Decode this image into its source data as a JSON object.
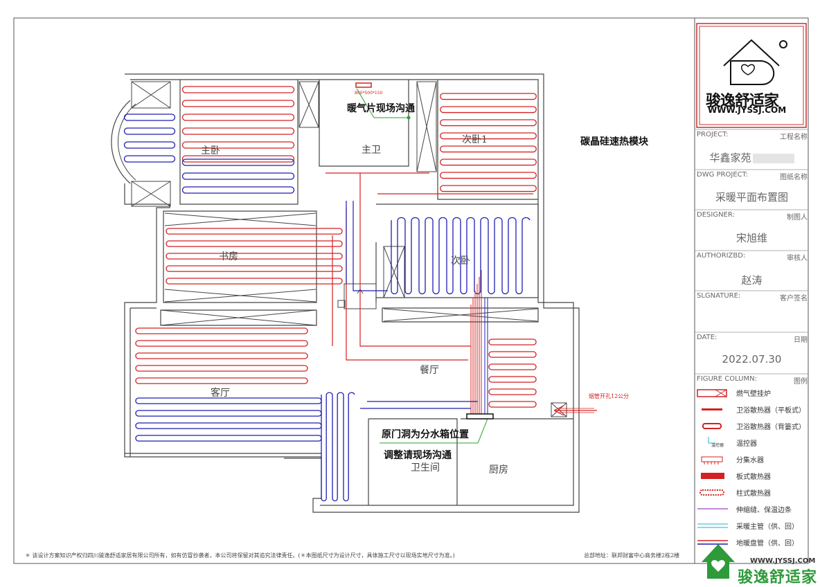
{
  "rooms": {
    "master_bedroom": "主卧",
    "master_bath": "主卫",
    "second_bedroom_1": "次卧1",
    "study": "书房",
    "second_bedroom": "次卧",
    "living_room": "客厅",
    "dining_room": "餐厅",
    "bathroom": "卫生间",
    "kitchen": "厨房"
  },
  "annotations": {
    "radiator_size": "800*500*150",
    "radiator_note": "暖气片现场沟通",
    "module_note": "碳晶硅速热模块",
    "chimney_note": "烟管开孔12公分",
    "manifold_note_1": "原门洞为分水箱位置",
    "manifold_note_2": "调整请现场沟通"
  },
  "title_block": {
    "logo_text": "骏逸舒适家",
    "logo_url": "WWW.JYSSJ.COM",
    "project_label": "PROJECT:",
    "project_label_cn": "工程名称",
    "project_value": "华鑫家苑",
    "dwg_label": "DWG PROJECT:",
    "dwg_label_cn": "图纸名称",
    "dwg_value": "采暖平面布置图",
    "designer_label": "DESIGNER:",
    "designer_label_cn": "制图人",
    "designer_value": "宋旭维",
    "author_label": "AUTHORIZBD:",
    "author_label_cn": "审核人",
    "author_value": "赵涛",
    "signature_label": "SLGNATURE:",
    "signature_label_cn": "客户签名",
    "date_label": "DATE:",
    "date_label_cn": "日期",
    "date_value": "2022.07.30",
    "figure_label": "FIGURE COLUMN:",
    "figure_label_cn": "图例"
  },
  "legend": [
    {
      "icon": "gas-boiler-icon",
      "label": "燃气壁挂炉"
    },
    {
      "icon": "flat-bath-radiator-icon",
      "label": "卫浴散热器（平板式）"
    },
    {
      "icon": "back-basket-bath-radiator-icon",
      "label": "卫浴散热器（背篓式）"
    },
    {
      "icon": "thermostat-icon",
      "label": "温控器"
    },
    {
      "icon": "manifold-icon",
      "label": "分集水器"
    },
    {
      "icon": "panel-radiator-icon",
      "label": "板式散热器"
    },
    {
      "icon": "column-radiator-icon",
      "label": "柱式散热器"
    },
    {
      "icon": "expansion-joint-line-icon",
      "label": "伸缩缝、保温边条"
    },
    {
      "icon": "main-pipe-line-icon",
      "label": "采暖主管（供、回）"
    },
    {
      "icon": "floor-heating-pipe-icon",
      "label": "地暖盘管（供、回）"
    }
  ],
  "thermostat_tag": "温控器",
  "footer": {
    "copyright": "＊ 该设计方案知识产权归四川骏逸舒适家居有限公司所有，如有仿冒抄袭者，本公司将保留对其追究法律责任。(＊本图纸尺寸为设计尺寸，具体施工尺寸以现场实地尺寸为准。)",
    "address": "总部地址：联邦财富中心商务楼2栋2楼"
  },
  "watermark": {
    "text": "骏逸舒适家",
    "url": "WWW.JYSSJ.COM"
  },
  "colors": {
    "red_loop": "#d42020",
    "blue_loop": "#1c1cb0",
    "purple_line": "#a040c0",
    "teal_line": "#20b0c8",
    "green_leader": "#2aa02a",
    "frame": "#b00000"
  }
}
